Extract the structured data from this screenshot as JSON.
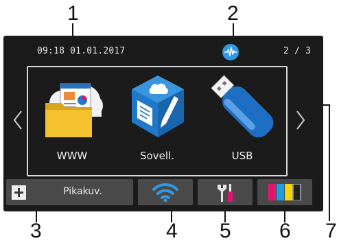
{
  "callouts": {
    "c1": "1",
    "c2": "2",
    "c3": "3",
    "c4": "4",
    "c5": "5",
    "c6": "6",
    "c7": "7"
  },
  "status": {
    "datetime": "09:18  01.01.2017",
    "page_indicator": "2 / 3",
    "wireless_icon": "wireless-direct-icon"
  },
  "apps": [
    {
      "label": "WWW",
      "icon": "web-folder-icon"
    },
    {
      "label": "Sovell.",
      "icon": "apps-cube-icon"
    },
    {
      "label": "USB",
      "icon": "usb-drive-icon"
    }
  ],
  "nav": {
    "prev_icon": "chevron-left-icon",
    "next_icon": "chevron-right-icon"
  },
  "bottom": {
    "shortcut_label": "Pikakuv.",
    "shortcut_icon": "plus-icon",
    "wifi_icon": "wifi-icon",
    "tools_icon": "tools-icon",
    "ink_icon": "ink-levels-icon"
  },
  "colors": {
    "screen_bg": "#1b1b1b",
    "button_bg": "#4a4a4a",
    "wifi": "#2f9be6",
    "cube": "#1f78c8",
    "usb": "#1e6fc4",
    "folder": "#f3c22c",
    "ink_magenta": "#e0146e",
    "ink_cyan": "#1aa0e0",
    "ink_yellow": "#f5d40a",
    "ink_black": "#222222"
  }
}
